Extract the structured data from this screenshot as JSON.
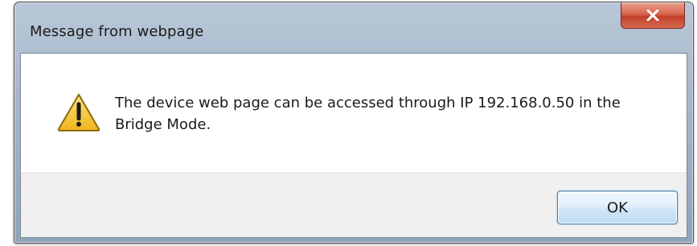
{
  "dialog": {
    "title": "Message from webpage",
    "message": "The device web page can be accessed through IP 192.168.0.50 in the Bridge Mode.",
    "ok_label": "OK",
    "icon": "warning-icon",
    "close_icon": "close-icon"
  },
  "colors": {
    "close_button": "#c2402b",
    "warning_fill": "#f4c430",
    "footer_bg": "#f0f0f0",
    "ok_button_border": "#3c7fb1"
  }
}
